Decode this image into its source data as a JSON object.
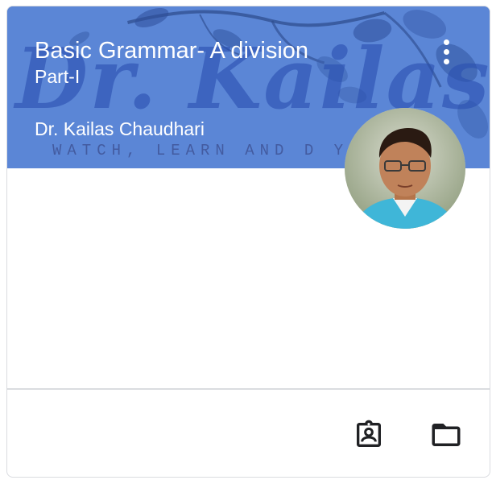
{
  "course_card": {
    "title": "Basic Grammar- A division",
    "section": "Part-I",
    "teacher": "Dr. Kailas Chaudhari",
    "banner_watermark": {
      "script_text": "Dr. Kailas Chau",
      "tagline": "WATCH, LEARN AND D          Y"
    },
    "banner_color": "#5a86d8",
    "more_options_icon": "more-vert-icon",
    "footer_icons": [
      "assignment-ind-icon",
      "folder-icon"
    ]
  }
}
